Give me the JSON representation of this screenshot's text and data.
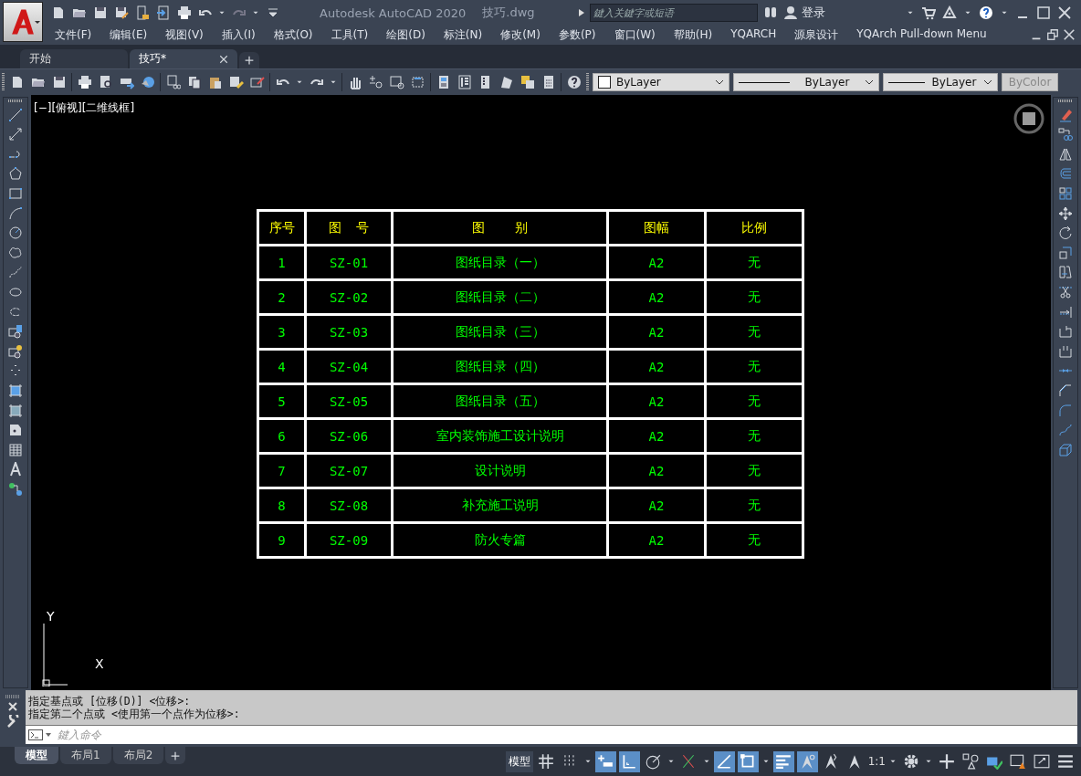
{
  "window": {
    "title": "Autodesk AutoCAD 2020",
    "file": "技巧.dwg"
  },
  "search": {
    "placeholder": "鍵入关鍵字或短语"
  },
  "user": {
    "label": "登录"
  },
  "menu": [
    "文件(F)",
    "编辑(E)",
    "视图(V)",
    "插入(I)",
    "格式(O)",
    "工具(T)",
    "绘图(D)",
    "标注(N)",
    "修改(M)",
    "参数(P)",
    "窗口(W)",
    "帮助(H)",
    "YQARCH",
    "源泉设计",
    "YQArch Pull-down Menu"
  ],
  "doc_tabs": [
    {
      "label": "开始",
      "selected": false
    },
    {
      "label": "技巧*",
      "selected": true
    }
  ],
  "properties": [
    {
      "kind": "color",
      "label": "ByLayer",
      "disabled": false
    },
    {
      "kind": "linetype",
      "label": "ByLayer",
      "disabled": false
    },
    {
      "kind": "lineweight",
      "label": "ByLayer",
      "disabled": false
    },
    {
      "kind": "plotstyle",
      "label": "ByColor",
      "disabled": true
    }
  ],
  "viewport": {
    "label": "[−][俯视][二维线框]"
  },
  "table": {
    "columns": [
      "序号",
      "图  号",
      "图    别",
      "图幅",
      "比例"
    ],
    "rows": [
      [
        "1",
        "SZ-01",
        "图纸目录（一）",
        "A2",
        "无"
      ],
      [
        "2",
        "SZ-02",
        "图纸目录（二）",
        "A2",
        "无"
      ],
      [
        "3",
        "SZ-03",
        "图纸目录（三）",
        "A2",
        "无"
      ],
      [
        "4",
        "SZ-04",
        "图纸目录（四）",
        "A2",
        "无"
      ],
      [
        "5",
        "SZ-05",
        "图纸目录（五）",
        "A2",
        "无"
      ],
      [
        "6",
        "SZ-06",
        "室内装饰施工设计说明",
        "A2",
        "无"
      ],
      [
        "7",
        "SZ-07",
        "设计说明",
        "A2",
        "无"
      ],
      [
        "8",
        "SZ-08",
        "补充施工说明",
        "A2",
        "无"
      ],
      [
        "9",
        "SZ-09",
        "防火专篇",
        "A2",
        "无"
      ]
    ]
  },
  "ucs": {
    "x": "X",
    "y": "Y"
  },
  "command": {
    "history": [
      "指定基点或 [位移(D)] <位移>:",
      "指定第二个点或 <使用第一个点作为位移>:"
    ],
    "placeholder": "鍵入命令"
  },
  "layout_tabs": [
    {
      "label": "模型",
      "selected": true
    },
    {
      "label": "布局1",
      "selected": false
    },
    {
      "label": "布局2",
      "selected": false
    }
  ],
  "status_bar": {
    "model": "模型",
    "scale": "1:1",
    "toggles": [
      {
        "on": false
      },
      {
        "on": false
      },
      {
        "on": true
      },
      {
        "on": true
      },
      {
        "on": false
      },
      {
        "on": false
      },
      {
        "on": true
      },
      {
        "on": true
      },
      {
        "on": true
      },
      {
        "on": true
      },
      {
        "on": false
      },
      {
        "on": false
      }
    ]
  }
}
